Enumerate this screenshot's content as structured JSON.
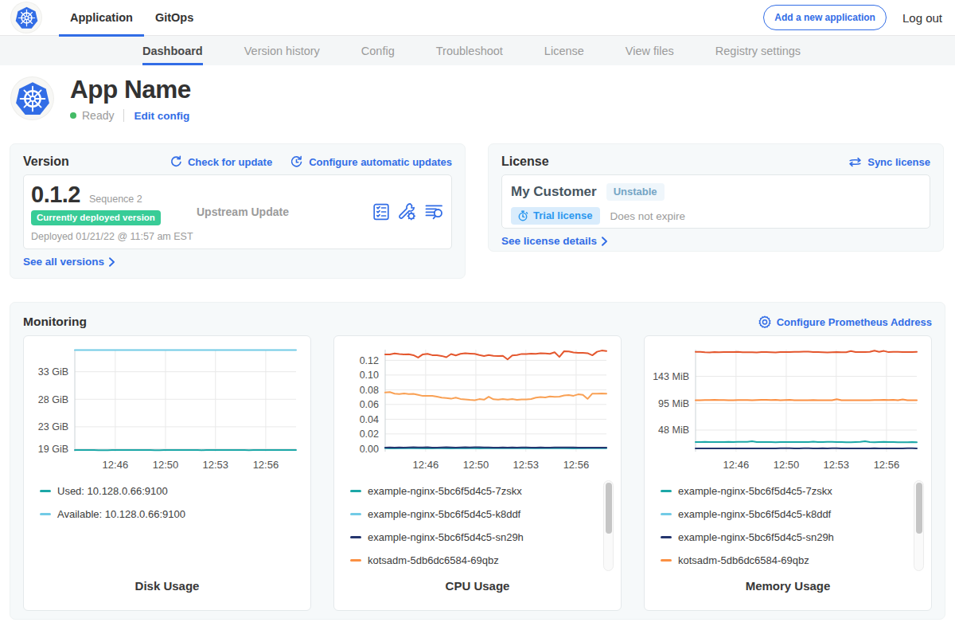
{
  "colors": {
    "primary": "#326de6",
    "green_badge": "#38cc97",
    "teal": "#1ca7a7",
    "light_blue": "#72cbe6",
    "navy": "#24356e",
    "orange": "#fb9043",
    "red_orange": "#e4572e"
  },
  "navbar": {
    "tabs": [
      {
        "label": "Application",
        "active": true
      },
      {
        "label": "GitOps",
        "active": false
      }
    ],
    "add_app_label": "Add a new application",
    "logout_label": "Log out"
  },
  "subnav": {
    "tabs": [
      {
        "label": "Dashboard",
        "active": true
      },
      {
        "label": "Version history",
        "active": false
      },
      {
        "label": "Config",
        "active": false
      },
      {
        "label": "Troubleshoot",
        "active": false
      },
      {
        "label": "License",
        "active": false
      },
      {
        "label": "View files",
        "active": false
      },
      {
        "label": "Registry settings",
        "active": false
      }
    ]
  },
  "app_header": {
    "name": "App Name",
    "status": "Ready",
    "edit_config_label": "Edit config"
  },
  "version_card": {
    "title": "Version",
    "check_update_label": "Check for update",
    "configure_updates_label": "Configure automatic updates",
    "version_number": "0.1.2",
    "sequence": "Sequence 2",
    "deployed_badge": "Currently deployed version",
    "deployed_text": "Deployed 01/21/22 @ 11:57 am EST",
    "upstream_label": "Upstream Update",
    "see_all_label": "See all versions"
  },
  "license_card": {
    "title": "License",
    "sync_label": "Sync license",
    "customer_name": "My Customer",
    "channel_badge": "Unstable",
    "type_badge": "Trial license",
    "expiry_text": "Does not expire",
    "see_details_label": "See license details"
  },
  "monitoring": {
    "title": "Monitoring",
    "configure_label": "Configure Prometheus Address"
  },
  "chart_data": [
    {
      "type": "line",
      "title": "Disk Usage",
      "ylim": [
        18.5,
        37.0
      ],
      "yticks": [
        {
          "label": "33 GiB",
          "value": 33
        },
        {
          "label": "28 GiB",
          "value": 28
        },
        {
          "label": "23 GiB",
          "value": 23
        },
        {
          "label": "19 GiB",
          "value": 19
        }
      ],
      "xticks": [
        {
          "label": "12:46",
          "frac": 0.183
        },
        {
          "label": "12:50",
          "frac": 0.41
        },
        {
          "label": "12:53",
          "frac": 0.636
        },
        {
          "label": "12:56",
          "frac": 0.863
        }
      ],
      "series": [
        {
          "color": "#72cbe6",
          "values": [
            36.92,
            36.93,
            36.92,
            36.92,
            36.93,
            36.92,
            36.93,
            36.93,
            36.92,
            36.92,
            36.92,
            36.92,
            36.92,
            36.91,
            36.92,
            36.92,
            36.91,
            36.92,
            36.92,
            36.92,
            36.92,
            36.93,
            36.92,
            36.92,
            36.92,
            36.92,
            36.92,
            36.92,
            36.93,
            36.92,
            36.92,
            36.92,
            36.93,
            36.91,
            36.92,
            36.92,
            36.92,
            36.92,
            36.91,
            36.92,
            36.92,
            36.91,
            36.92,
            36.93,
            36.92,
            36.92,
            36.93,
            36.92
          ]
        },
        {
          "color": "#1ca7a7",
          "values": [
            18.78,
            18.79,
            18.78,
            18.79,
            18.77,
            18.76,
            18.76,
            18.76,
            18.78,
            18.78,
            18.78,
            18.77,
            18.77,
            18.77,
            18.79,
            18.8,
            18.8,
            18.76,
            18.76,
            18.8,
            18.78,
            18.79,
            18.77,
            18.78,
            18.78,
            18.78,
            18.78,
            18.76,
            18.79,
            18.79,
            18.77,
            18.78,
            18.79,
            18.78,
            18.77,
            18.77,
            18.78,
            18.76,
            18.8,
            18.79,
            18.79,
            18.79,
            18.79,
            18.78,
            18.78,
            18.78,
            18.8,
            18.79
          ]
        }
      ],
      "legend": [
        {
          "label": "Used: 10.128.0.66:9100",
          "color": "#1ca7a7"
        },
        {
          "label": "Available: 10.128.0.66:9100",
          "color": "#72cbe6"
        }
      ],
      "legend_scrollbar": false
    },
    {
      "type": "line",
      "title": "CPU Usage",
      "ylim": [
        -0.004,
        0.1345
      ],
      "yticks": [
        {
          "label": "0.12",
          "value": 0.12
        },
        {
          "label": "0.10",
          "value": 0.1
        },
        {
          "label": "0.08",
          "value": 0.08
        },
        {
          "label": "0.06",
          "value": 0.06
        },
        {
          "label": "0.04",
          "value": 0.04
        },
        {
          "label": "0.02",
          "value": 0.02
        },
        {
          "label": "0.00",
          "value": 0.0
        }
      ],
      "xticks": [
        {
          "label": "12:46",
          "frac": 0.183
        },
        {
          "label": "12:50",
          "frac": 0.41
        },
        {
          "label": "12:53",
          "frac": 0.636
        },
        {
          "label": "12:56",
          "frac": 0.863
        }
      ],
      "series": [
        {
          "color": "#72cbe6",
          "values": [
            0.0005,
            0.0006,
            0.0004,
            0.0005,
            0.0004,
            0.0005,
            0.0005,
            0.0004,
            0.0005,
            0.0005,
            0.0005,
            0.0006,
            0.0005,
            0.0004,
            0.0004,
            0.0005,
            0.0004,
            0.0004,
            0.0005,
            0.0006,
            0.0005,
            0.0006,
            0.0005,
            0.0005,
            0.0005,
            0.0005,
            0.0005,
            0.0006,
            0.0006,
            0.0005,
            0.0005,
            0.0005,
            0.0004,
            0.0005,
            0.0006,
            0.0006,
            0.0006,
            0.0006,
            0.0005,
            0.0004,
            0.0005,
            0.0004,
            0.0004,
            0.0005,
            0.0005,
            0.0005,
            0.0005,
            0.0006
          ]
        },
        {
          "color": "#1ca7a7",
          "values": [
            0.0008,
            0.0007,
            0.0007,
            0.0009,
            0.001,
            0.0009,
            0.0009,
            0.0009,
            0.0007,
            0.0006,
            0.0006,
            0.0008,
            0.0009,
            0.001,
            0.0007,
            0.0008,
            0.0008,
            0.0009,
            0.0008,
            0.0009,
            0.0007,
            0.0008,
            0.0009,
            0.0009,
            0.0009,
            0.0009,
            0.0009,
            0.001,
            0.0008,
            0.0009,
            0.0009,
            0.001,
            0.0008,
            0.0009,
            0.001,
            0.0009,
            0.0009,
            0.0008,
            0.0008,
            0.0008,
            0.0007,
            0.0008,
            0.0009,
            0.001,
            0.0009,
            0.0008,
            0.0009,
            0.0009
          ]
        },
        {
          "color": "#24356e",
          "values": [
            0.0014,
            0.0016,
            0.0015,
            0.0016,
            0.0015,
            0.0016,
            0.0018,
            0.0017,
            0.0017,
            0.0018,
            0.0015,
            0.0014,
            0.0017,
            0.0018,
            0.0016,
            0.0015,
            0.0016,
            0.0018,
            0.0016,
            0.0018,
            0.0018,
            0.0017,
            0.0016,
            0.0014,
            0.0014,
            0.0017,
            0.0015,
            0.0017,
            0.0015,
            0.0017,
            0.0017,
            0.0015,
            0.0014,
            0.0016,
            0.0014,
            0.0014,
            0.0016,
            0.0017,
            0.0017,
            0.0016,
            0.0017,
            0.0015,
            0.0014,
            0.0014,
            0.0015,
            0.0014,
            0.0014,
            0.0015
          ]
        },
        {
          "color": "#f9a155",
          "values": [
            0.0763,
            0.0768,
            0.0748,
            0.0741,
            0.075,
            0.0741,
            0.0746,
            0.0732,
            0.0716,
            0.0717,
            0.0719,
            0.0705,
            0.0692,
            0.0688,
            0.0678,
            0.0694,
            0.0675,
            0.0669,
            0.0662,
            0.0658,
            0.0673,
            0.0666,
            0.0706,
            0.0671,
            0.0665,
            0.0675,
            0.0666,
            0.0673,
            0.0664,
            0.067,
            0.067,
            0.0674,
            0.0694,
            0.0702,
            0.0697,
            0.071,
            0.0704,
            0.0708,
            0.0722,
            0.0727,
            0.0719,
            0.0738,
            0.0732,
            0.0676,
            0.0748,
            0.0747,
            0.0749,
            0.0747
          ]
        },
        {
          "color": "#e4572e",
          "values": [
            0.128,
            0.1281,
            0.1293,
            0.1284,
            0.1281,
            0.1282,
            0.127,
            0.1238,
            0.1281,
            0.1289,
            0.127,
            0.1268,
            0.126,
            0.1242,
            0.1285,
            0.1267,
            0.1288,
            0.1297,
            0.1292,
            0.1288,
            0.1271,
            0.126,
            0.1271,
            0.1261,
            0.126,
            0.1262,
            0.1213,
            0.1267,
            0.1271,
            0.1287,
            0.1285,
            0.129,
            0.1289,
            0.1295,
            0.1293,
            0.1288,
            0.131,
            0.1246,
            0.1323,
            0.132,
            0.1308,
            0.1302,
            0.1302,
            0.1297,
            0.1268,
            0.1317,
            0.1333,
            0.1327
          ]
        }
      ],
      "legend": [
        {
          "label": "example-nginx-5bc6f5d4c5-7zskx",
          "color": "#1ca7a7"
        },
        {
          "label": "example-nginx-5bc6f5d4c5-k8ddf",
          "color": "#72cbe6"
        },
        {
          "label": "example-nginx-5bc6f5d4c5-sn29h",
          "color": "#24356e"
        },
        {
          "label": "kotsadm-5db6dc6584-69qbz",
          "color": "#fb9043"
        }
      ],
      "legend_scrollbar": true
    },
    {
      "type": "line",
      "title": "Memory Usage",
      "ylim": [
        10,
        190
      ],
      "yticks": [
        {
          "label": "143 MiB",
          "value": 143
        },
        {
          "label": "95 MiB",
          "value": 95
        },
        {
          "label": "48 MiB",
          "value": 48
        }
      ],
      "xticks": [
        {
          "label": "12:46",
          "frac": 0.183
        },
        {
          "label": "12:50",
          "frac": 0.41
        },
        {
          "label": "12:53",
          "frac": 0.636
        },
        {
          "label": "12:56",
          "frac": 0.863
        }
      ],
      "series": [
        {
          "color": "#24356e",
          "values": [
            15.8,
            15.8,
            15.7,
            15.8,
            15.7,
            15.8,
            15.7,
            15.7,
            15.8,
            15.8,
            15.8,
            15.8,
            15.8,
            15.7,
            15.7,
            15.8,
            15.8,
            15.8,
            15.9,
            15.9,
            15.9,
            15.8,
            15.8,
            15.9,
            15.9,
            15.8,
            15.8,
            15.9,
            15.8,
            15.9,
            15.9,
            15.8,
            15.7,
            15.8,
            15.8,
            15.7,
            15.8,
            15.8,
            15.9,
            15.8,
            15.8,
            15.8,
            15.7,
            15.7,
            15.8,
            15.9,
            15.9,
            15.8
          ]
        },
        {
          "color": "#1ca7a7",
          "values": [
            26.9,
            26.9,
            27.1,
            27.0,
            26.8,
            26.7,
            27.0,
            27.2,
            26.8,
            27.1,
            27.3,
            27.1,
            28.1,
            26.7,
            26.8,
            26.8,
            26.9,
            26.5,
            27.0,
            26.9,
            26.8,
            27.0,
            27.0,
            26.9,
            27.0,
            27.7,
            26.7,
            26.7,
            27.1,
            27.3,
            26.9,
            26.8,
            26.5,
            26.6,
            27.0,
            27.2,
            28.2,
            26.7,
            26.5,
            26.8,
            27.1,
            26.7,
            27.0,
            26.5,
            26.4,
            26.4,
            26.7,
            26.6
          ]
        },
        {
          "color": "#fb9043",
          "values": [
            100.7,
            100.8,
            101.1,
            101.1,
            101.3,
            101.0,
            101.0,
            100.7,
            100.9,
            101.1,
            101.0,
            101.1,
            100.7,
            101.0,
            101.3,
            101.4,
            101.1,
            101.2,
            100.9,
            101.1,
            101.2,
            100.9,
            100.6,
            100.6,
            100.8,
            101.0,
            100.9,
            100.5,
            100.9,
            100.5,
            102.4,
            100.6,
            100.6,
            100.9,
            100.6,
            100.5,
            100.6,
            100.9,
            101.1,
            101.1,
            101.2,
            101.0,
            101.2,
            100.7,
            102.1,
            100.7,
            100.6,
            100.9
          ]
        },
        {
          "color": "#e4572e",
          "values": [
            186.2,
            186.0,
            185.5,
            185.2,
            185.9,
            185.4,
            185.8,
            185.9,
            185.7,
            186.0,
            185.5,
            185.3,
            185.5,
            185.2,
            185.8,
            185.6,
            185.4,
            185.2,
            185.6,
            185.7,
            185.8,
            186.0,
            186.2,
            186.4,
            186.3,
            185.8,
            185.8,
            185.5,
            185.2,
            185.5,
            185.8,
            185.5,
            185.5,
            187.6,
            185.8,
            185.8,
            185.9,
            186.1,
            188.2,
            186.1,
            187.7,
            185.7,
            186.1,
            186.2,
            185.6,
            185.7,
            185.9,
            186.2
          ]
        }
      ],
      "legend": [
        {
          "label": "example-nginx-5bc6f5d4c5-7zskx",
          "color": "#1ca7a7"
        },
        {
          "label": "example-nginx-5bc6f5d4c5-k8ddf",
          "color": "#72cbe6"
        },
        {
          "label": "example-nginx-5bc6f5d4c5-sn29h",
          "color": "#24356e"
        },
        {
          "label": "kotsadm-5db6dc6584-69qbz",
          "color": "#fb9043"
        }
      ],
      "legend_scrollbar": true
    }
  ]
}
